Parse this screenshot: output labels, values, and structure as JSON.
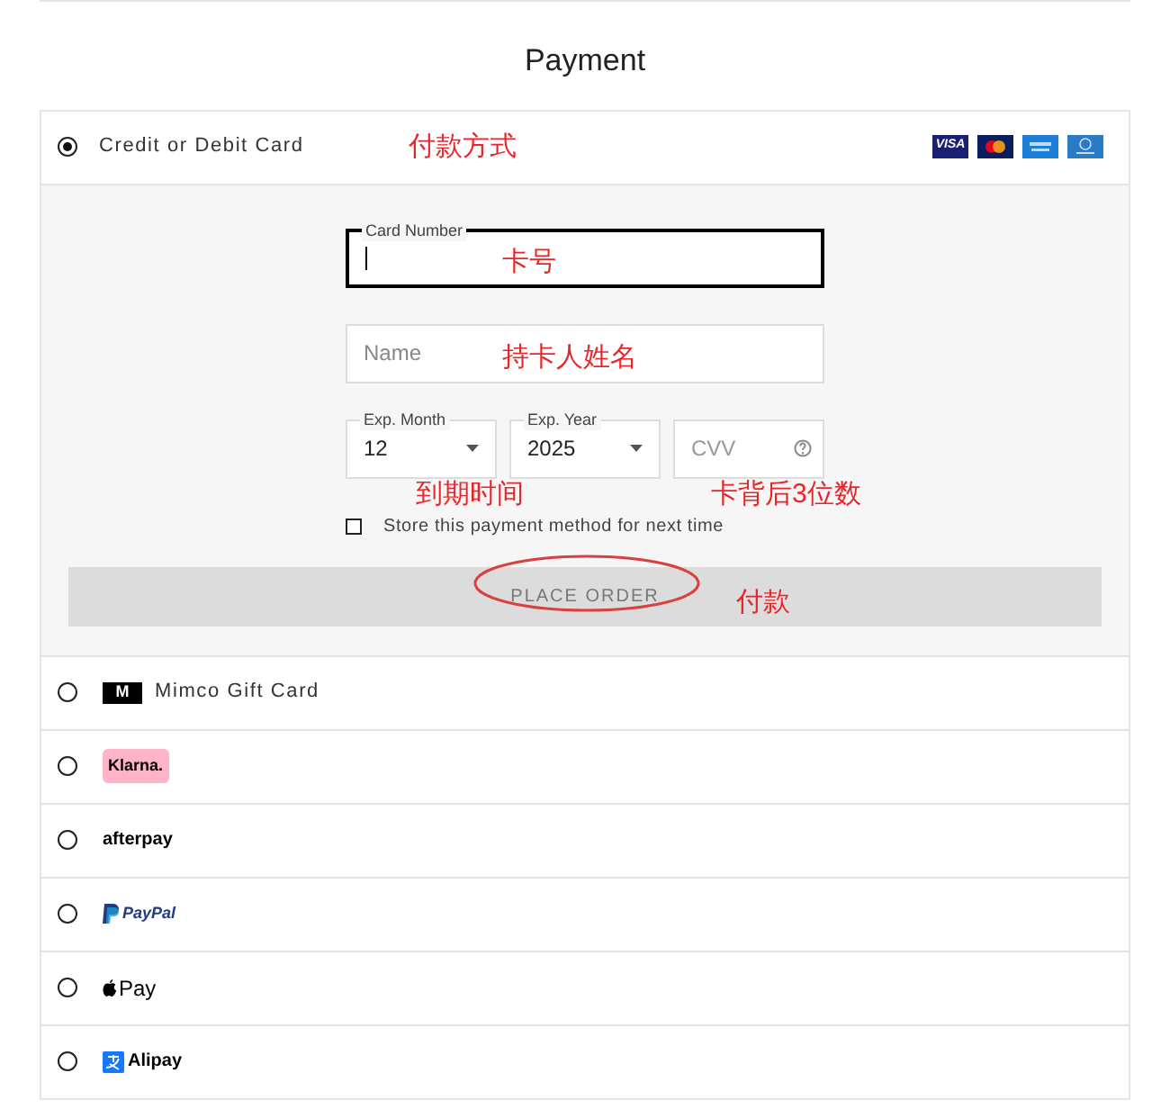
{
  "title": "Payment",
  "methods": [
    {
      "kind": "card",
      "label": "Credit or Debit Card",
      "selected": true,
      "brands": [
        "VISA"
      ]
    },
    {
      "kind": "gift",
      "logo": "M",
      "label": "Mimco Gift Card",
      "selected": false
    },
    {
      "kind": "klarna",
      "logo": "Klarna.",
      "selected": false
    },
    {
      "kind": "afterpay",
      "logo": "afterpay",
      "selected": false
    },
    {
      "kind": "paypal",
      "logo": "PayPal",
      "selected": false
    },
    {
      "kind": "applepay",
      "logo": "Pay",
      "selected": false
    },
    {
      "kind": "alipay",
      "logo": "Alipay",
      "selected": false
    }
  ],
  "card_form": {
    "card_number": {
      "label": "Card Number",
      "focused": true
    },
    "name": {
      "placeholder": "Name"
    },
    "exp_month": {
      "label": "Exp. Month",
      "value": "12"
    },
    "exp_year": {
      "label": "Exp. Year",
      "value": "2025"
    },
    "cvv": {
      "placeholder": "CVV"
    },
    "store": {
      "label": "Store this payment method for next time",
      "checked": false
    },
    "button": "PLACE ORDER"
  },
  "annotations": [
    "付款方式",
    "卡号",
    "持卡人姓名",
    "到期时间",
    "卡背后3位数",
    "付款"
  ]
}
